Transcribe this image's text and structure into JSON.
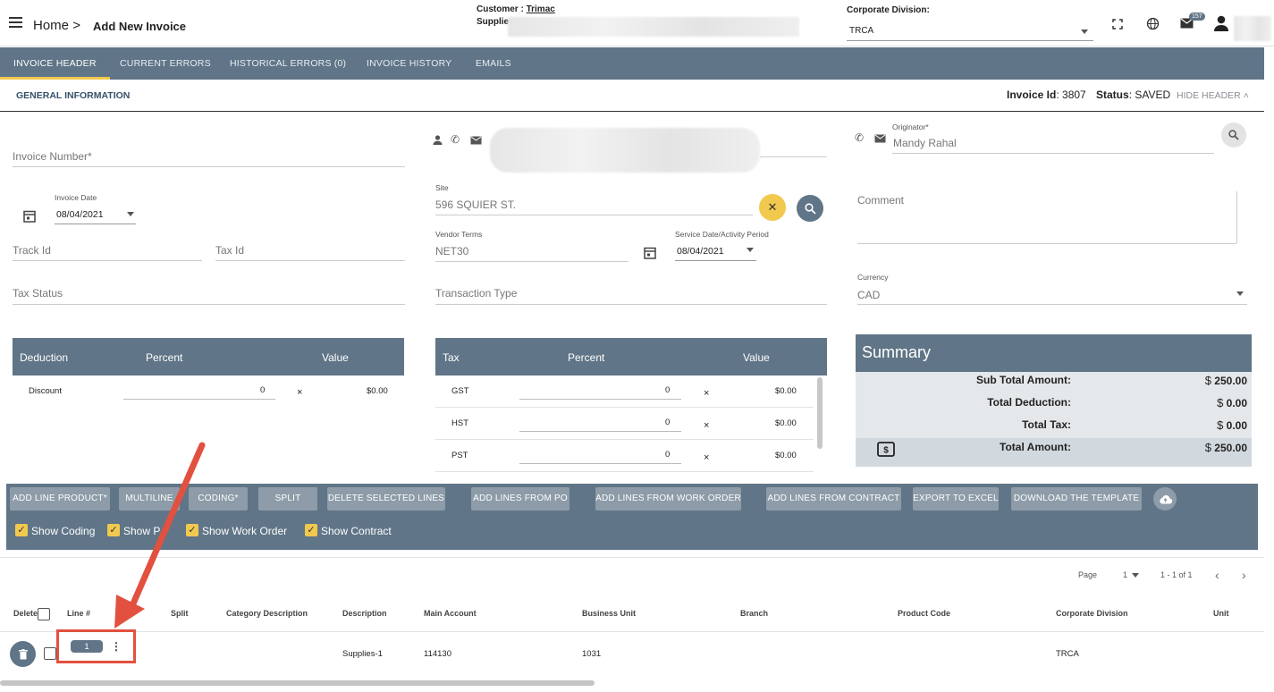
{
  "breadcrumb": {
    "home": "Home",
    "separator": ">",
    "current": "Add New Invoice"
  },
  "header": {
    "customer_label": "Customer :",
    "customer_value": "Trimac",
    "supplier_label": "Supplier",
    "corporate_division_label": "Corporate Division:",
    "corporate_division_value": "TRCA",
    "notification_count": "157"
  },
  "tabs": [
    {
      "label": "INVOICE HEADER"
    },
    {
      "label": "CURRENT ERRORS"
    },
    {
      "label": "HISTORICAL ERRORS (0)"
    },
    {
      "label": "INVOICE HISTORY"
    },
    {
      "label": "EMAILS"
    }
  ],
  "section": {
    "title": "GENERAL INFORMATION",
    "invoice_id_label": "Invoice Id",
    "invoice_id_value": "3807",
    "status_label": "Status",
    "status_value": "SAVED",
    "hide_header": "HIDE HEADER"
  },
  "form": {
    "invoice_number": "Invoice Number*",
    "invoice_date_label": "Invoice Date",
    "invoice_date_value": "08/04/2021",
    "track_id": "Track Id",
    "tax_id": "Tax Id",
    "tax_status": "Tax Status",
    "site_label": "Site",
    "site_value": "596 SQUIER ST.",
    "vendor_terms_label": "Vendor Terms",
    "vendor_terms_value": "NET30",
    "service_date_label": "Service Date/Activity Period",
    "service_date_value": "08/04/2021",
    "transaction_type": "Transaction Type",
    "originator_label": "Originator*",
    "originator_value": "Mandy Rahal",
    "comment": "Comment",
    "currency_label": "Currency",
    "currency_value": "CAD"
  },
  "deduction_table": {
    "headers": [
      "Deduction",
      "Percent",
      "Value"
    ],
    "rows": [
      {
        "name": "Discount",
        "percent": "0",
        "value": "$0.00"
      }
    ]
  },
  "tax_table": {
    "headers": [
      "Tax",
      "Percent",
      "Value"
    ],
    "rows": [
      {
        "name": "GST",
        "percent": "0",
        "value": "$0.00"
      },
      {
        "name": "HST",
        "percent": "0",
        "value": "$0.00"
      },
      {
        "name": "PST",
        "percent": "0",
        "value": "$0.00"
      }
    ]
  },
  "summary": {
    "title": "Summary",
    "currency_symbol": "$",
    "rows": [
      {
        "label": "Sub Total Amount:",
        "value": "250.00"
      },
      {
        "label": "Total Deduction:",
        "value": "0.00"
      },
      {
        "label": "Total Tax:",
        "value": "0.00"
      },
      {
        "label": "Total Amount:",
        "value": "250.00"
      }
    ]
  },
  "toolbar": {
    "buttons": [
      "ADD LINE PRODUCT*",
      "MULTILINE",
      "CODING*",
      "SPLIT",
      "DELETE SELECTED LINES",
      "ADD LINES FROM PO",
      "ADD LINES FROM WORK ORDER",
      "ADD LINES FROM CONTRACT",
      "EXPORT TO EXCEL",
      "DOWNLOAD THE TEMPLATE"
    ],
    "checkboxes": [
      "Show Coding",
      "Show P",
      "Show Work Order",
      "Show Contract"
    ]
  },
  "pager": {
    "page_label": "Page",
    "page_value": "1",
    "range": "1 - 1 of 1"
  },
  "grid": {
    "columns": [
      "Delete",
      "Line #",
      "Split",
      "Category Description",
      "Description",
      "Main Account",
      "Business Unit",
      "Branch",
      "Product Code",
      "Corporate Division",
      "Unit"
    ],
    "rows": [
      {
        "line": "1",
        "description": "Supplies-1",
        "main_account": "114130",
        "business_unit": "1031",
        "corporate_division": "TRCA"
      }
    ]
  },
  "colors": {
    "header_bg": "#607587",
    "accent": "#f1c94e",
    "annotation": "#e2513f"
  }
}
